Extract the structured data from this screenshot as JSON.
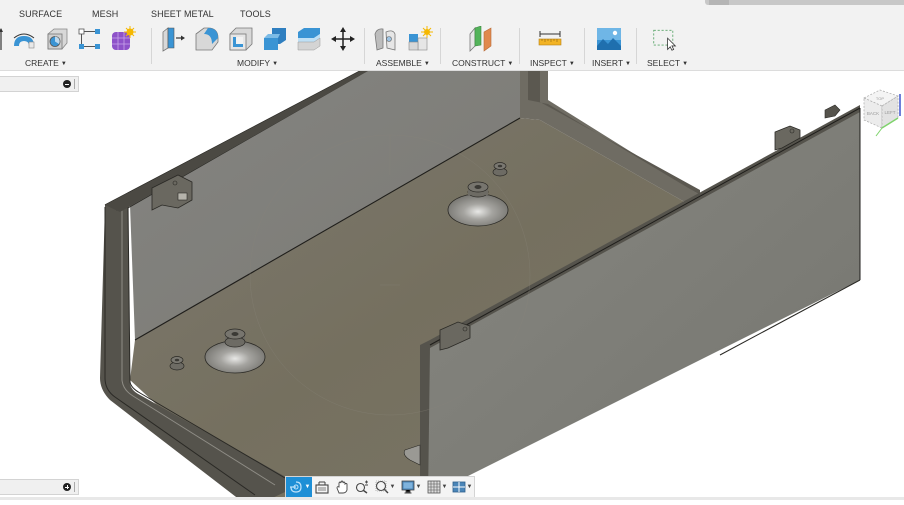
{
  "toolbar": {
    "tabs": [
      "SURFACE",
      "MESH",
      "SHEET METAL",
      "TOOLS"
    ],
    "groups": {
      "create": {
        "label": "CREATE",
        "icons": [
          "extrude-icon",
          "revolve-icon",
          "hole-icon",
          "sketch-pattern-icon",
          "form-icon"
        ]
      },
      "modify": {
        "label": "MODIFY",
        "icons": [
          "press-pull-icon",
          "fillet-icon",
          "shell-icon",
          "combine-icon",
          "offset-face-icon",
          "move-icon"
        ]
      },
      "assemble": {
        "label": "ASSEMBLE",
        "icons": [
          "joint-icon",
          "new-component-icon"
        ]
      },
      "construct": {
        "label": "CONSTRUCT",
        "icons": [
          "offset-plane-icon"
        ]
      },
      "inspect": {
        "label": "INSPECT",
        "icons": [
          "measure-icon"
        ]
      },
      "insert": {
        "label": "INSERT",
        "icons": [
          "insert-image-icon"
        ]
      },
      "select": {
        "label": "SELECT",
        "icons": [
          "window-select-icon"
        ]
      }
    }
  },
  "panels": {
    "browser_collapse": "collapse",
    "comments_expand": "expand"
  },
  "viewcube": {
    "faces": [
      "TOP",
      "BACK",
      "LEFT"
    ]
  },
  "navbar": {
    "items": [
      "orbit",
      "look-at",
      "pan",
      "zoom",
      "fit",
      "display-settings",
      "grid-settings",
      "viewports"
    ]
  },
  "colors": {
    "accent": "#1e8fd6",
    "model_wall": "#7d7c75",
    "model_floor": "#766f63",
    "toolbar_bg": "#f2f2f2"
  }
}
